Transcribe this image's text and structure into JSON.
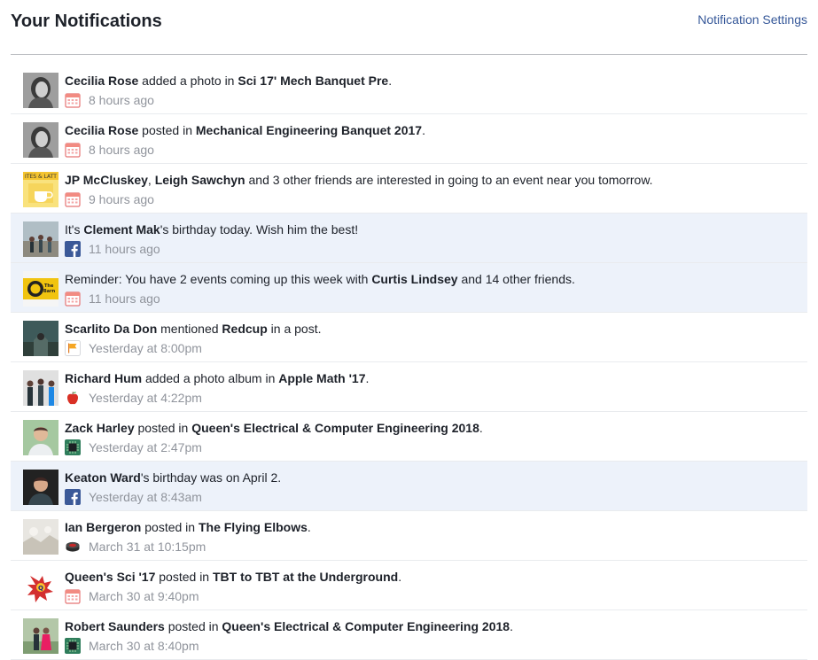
{
  "header": {
    "title": "Your Notifications",
    "settings_label": "Notification Settings"
  },
  "notifications": [
    {
      "parts": [
        {
          "t": "Cecilia Rose",
          "b": true
        },
        {
          "t": " added a photo in ",
          "b": false
        },
        {
          "t": "Sci 17' Mech Banquet Pre",
          "b": true
        },
        {
          "t": ".",
          "b": false
        }
      ],
      "icon": "calendar-icon",
      "time": "8 hours ago",
      "unread": false,
      "avatar": "cecilia-rose-avatar"
    },
    {
      "parts": [
        {
          "t": "Cecilia Rose",
          "b": true
        },
        {
          "t": " posted in ",
          "b": false
        },
        {
          "t": "Mechanical Engineering Banquet 2017",
          "b": true
        },
        {
          "t": ".",
          "b": false
        }
      ],
      "icon": "calendar-icon",
      "time": "8 hours ago",
      "unread": false,
      "avatar": "cecilia-rose-avatar"
    },
    {
      "parts": [
        {
          "t": "JP McCluskey",
          "b": true
        },
        {
          "t": ", ",
          "b": false
        },
        {
          "t": "Leigh Sawchyn",
          "b": true
        },
        {
          "t": " and 3 other friends are interested in going to an event near you tomorrow.",
          "b": false
        }
      ],
      "icon": "calendar-icon",
      "time": "9 hours ago",
      "unread": false,
      "avatar": "event-cafe-avatar"
    },
    {
      "parts": [
        {
          "t": "It's ",
          "b": false
        },
        {
          "t": "Clement Mak",
          "b": true
        },
        {
          "t": "'s birthday today. Wish him the best!",
          "b": false
        }
      ],
      "icon": "facebook-icon",
      "time": "11 hours ago",
      "unread": true,
      "avatar": "clement-mak-avatar"
    },
    {
      "parts": [
        {
          "t": "Reminder: You have 2 events coming up this week with ",
          "b": false
        },
        {
          "t": "Curtis Lindsey",
          "b": true
        },
        {
          "t": " and 14 other friends.",
          "b": false
        }
      ],
      "icon": "calendar-icon",
      "time": "11 hours ago",
      "unread": true,
      "avatar": "events-reminder-avatar"
    },
    {
      "parts": [
        {
          "t": "Scarlito Da Don",
          "b": true
        },
        {
          "t": " mentioned ",
          "b": false
        },
        {
          "t": "Redcup",
          "b": true
        },
        {
          "t": " in a post.",
          "b": false
        }
      ],
      "icon": "flag-icon",
      "time": "Yesterday at 8:00pm",
      "unread": false,
      "avatar": "scarlito-avatar"
    },
    {
      "parts": [
        {
          "t": "Richard Hum",
          "b": true
        },
        {
          "t": " added a photo album in ",
          "b": false
        },
        {
          "t": "Apple Math '17",
          "b": true
        },
        {
          "t": ".",
          "b": false
        }
      ],
      "icon": "apple-icon",
      "time": "Yesterday at 4:22pm",
      "unread": false,
      "avatar": "richard-hum-avatar"
    },
    {
      "parts": [
        {
          "t": "Zack Harley",
          "b": true
        },
        {
          "t": " posted in ",
          "b": false
        },
        {
          "t": "Queen's Electrical & Computer Engineering 2018",
          "b": true
        },
        {
          "t": ".",
          "b": false
        }
      ],
      "icon": "chip-icon",
      "time": "Yesterday at 2:47pm",
      "unread": false,
      "avatar": "zack-harley-avatar"
    },
    {
      "parts": [
        {
          "t": "Keaton Ward",
          "b": true
        },
        {
          "t": "'s birthday was on April 2.",
          "b": false
        }
      ],
      "icon": "facebook-icon",
      "time": "Yesterday at 8:43am",
      "unread": true,
      "avatar": "keaton-ward-avatar"
    },
    {
      "parts": [
        {
          "t": "Ian Bergeron",
          "b": true
        },
        {
          "t": " posted in ",
          "b": false
        },
        {
          "t": "The Flying Elbows",
          "b": true
        },
        {
          "t": ".",
          "b": false
        }
      ],
      "icon": "hockey-puck-icon",
      "time": "March 31 at 10:15pm",
      "unread": false,
      "avatar": "ian-bergeron-avatar"
    },
    {
      "parts": [
        {
          "t": "Queen's Sci '17",
          "b": true
        },
        {
          "t": " posted in ",
          "b": false
        },
        {
          "t": "TBT to TBT at the Underground",
          "b": true
        },
        {
          "t": ".",
          "b": false
        }
      ],
      "icon": "calendar-icon",
      "time": "March 30 at 9:40pm",
      "unread": false,
      "avatar": "queens-sci-avatar"
    },
    {
      "parts": [
        {
          "t": "Robert Saunders",
          "b": true
        },
        {
          "t": " posted in ",
          "b": false
        },
        {
          "t": "Queen's Electrical & Computer Engineering 2018",
          "b": true
        },
        {
          "t": ".",
          "b": false
        }
      ],
      "icon": "chip-icon",
      "time": "March 30 at 8:40pm",
      "unread": false,
      "avatar": "robert-saunders-avatar"
    }
  ],
  "colors": {
    "link": "#365899",
    "unread_bg": "#edf2fa",
    "meta_text": "#90949c",
    "body_text": "#1d2129"
  }
}
